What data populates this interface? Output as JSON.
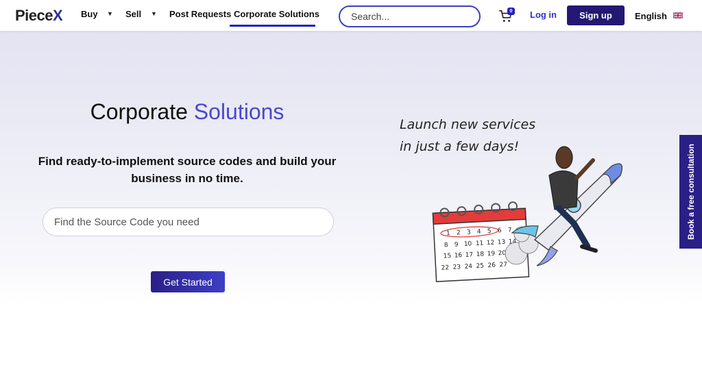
{
  "nav": {
    "logo_main": "Piece",
    "logo_accent": "X",
    "items": [
      {
        "label": "Buy"
      },
      {
        "label": "Sell"
      },
      {
        "label": "Post Requests"
      },
      {
        "label": "Corporate Solutions"
      }
    ],
    "search_placeholder": "Search...",
    "cart_count": "0",
    "login": "Log in",
    "signup": "Sign up",
    "language": "English"
  },
  "hero": {
    "title_main": "Corporate",
    "title_accent": "Solutions",
    "subtitle": "Find ready-to-implement source codes and build your business in no time.",
    "input_placeholder": "Find the Source Code you need",
    "cta": "Get Started"
  },
  "illustration": {
    "line1": "Launch new services",
    "line2": "in just a few days!",
    "calendar_rows": [
      [
        "1",
        "2",
        "3",
        "4",
        "5",
        "6",
        "7"
      ],
      [
        "8",
        "9",
        "10",
        "11",
        "12",
        "13",
        "14"
      ],
      [
        "15",
        "16",
        "17",
        "18",
        "19",
        "20"
      ],
      [
        "22",
        "23",
        "24",
        "25",
        "26",
        "27"
      ]
    ]
  },
  "side_tab": "Book a free consultation",
  "colors": {
    "brand": "#241873",
    "accent": "#4b47cf",
    "link": "#2f33c9"
  }
}
